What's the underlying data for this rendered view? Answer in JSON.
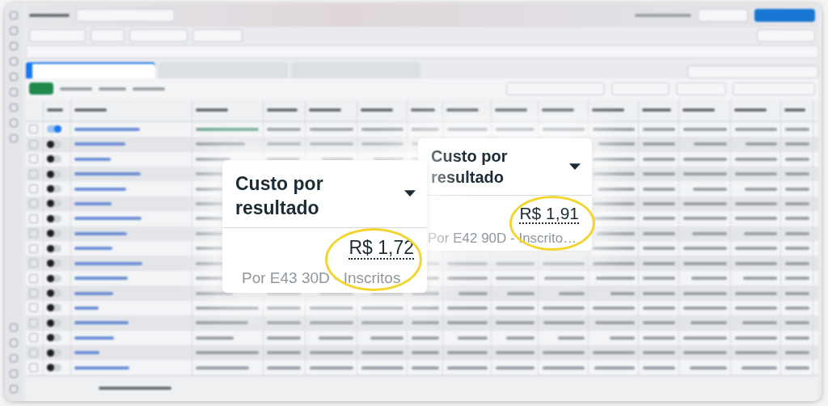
{
  "tabs": [
    {
      "selected": true
    },
    {
      "selected": false
    },
    {
      "selected": false
    }
  ],
  "campaign_rows": [
    {
      "on": true
    },
    {
      "on": false
    },
    {
      "on": false
    },
    {
      "on": false
    },
    {
      "on": false
    },
    {
      "on": false
    },
    {
      "on": false
    },
    {
      "on": false
    },
    {
      "on": false
    },
    {
      "on": false
    },
    {
      "on": false
    },
    {
      "on": false
    },
    {
      "on": false
    },
    {
      "on": false
    },
    {
      "on": false
    },
    {
      "on": false
    },
    {
      "on": false
    }
  ],
  "callouts": [
    {
      "title": "Custo por resultado",
      "value": "R$ 1,91",
      "subtitle": "Por E42 90D - Inscrito…",
      "highlighted": true
    },
    {
      "title": "Custo por resultado",
      "value": "R$ 1,72",
      "subtitle": "Por E43 30D - Inscritos",
      "highlighted": true
    }
  ]
}
